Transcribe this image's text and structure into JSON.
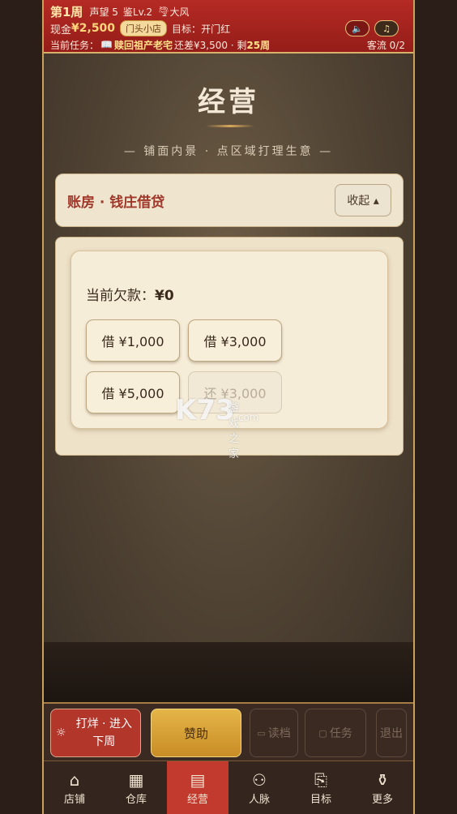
{
  "hud": {
    "week": "第1周",
    "reputation": "声望 5",
    "appraise": "鉴Lv.2",
    "weather_icon": "tornado-icon",
    "weather": "大风",
    "cash_label": "现金",
    "cash_value": "¥2,500",
    "shop_badge": "门头小店",
    "goal_label": "目标：",
    "goal_value": "开门红",
    "task_label": "当前任务：",
    "task_icon": "book-icon",
    "task_name": "赎回祖产老宅",
    "task_rest": "还差¥3,500 · 剩",
    "task_weeks": "25周",
    "sound_icon": "🔈",
    "music_icon": "♫",
    "guest_flow": "客流 0/2"
  },
  "scene": {
    "title": "经营",
    "subtitle": "— 铺面内景 · 点区域打理生意 —",
    "panel_title": "账房 · 钱庄借贷",
    "collapse_label": "收起 ▴",
    "debt_label": "当前欠款：",
    "debt_value": "¥0",
    "loan_buttons": [
      "借 ¥1,000",
      "借 ¥3,000",
      "借 ¥5,000",
      "还 ¥3,000"
    ]
  },
  "actions": {
    "end_week_icon": "☼",
    "end_week_label": "打烊 · 进入\n下周",
    "sponsor": "赞助",
    "load": "读档",
    "task": "任务",
    "quit": "退出"
  },
  "tabs": [
    {
      "label": "店铺",
      "icon": "shop-icon"
    },
    {
      "label": "仓库",
      "icon": "warehouse-icon"
    },
    {
      "label": "经营",
      "icon": "ledger-icon"
    },
    {
      "label": "人脉",
      "icon": "people-icon"
    },
    {
      "label": "目标",
      "icon": "scroll-icon"
    },
    {
      "label": "更多",
      "icon": "more-icon"
    }
  ],
  "watermark": {
    "brand": "K73",
    "line1": "游戏之家",
    "line2": ".com"
  },
  "colors": {
    "hud_red": "#b52a24",
    "accent_gold": "#d8b26a",
    "active_tab": "#c23a2e",
    "sponsor_gold": "#e4b548"
  }
}
